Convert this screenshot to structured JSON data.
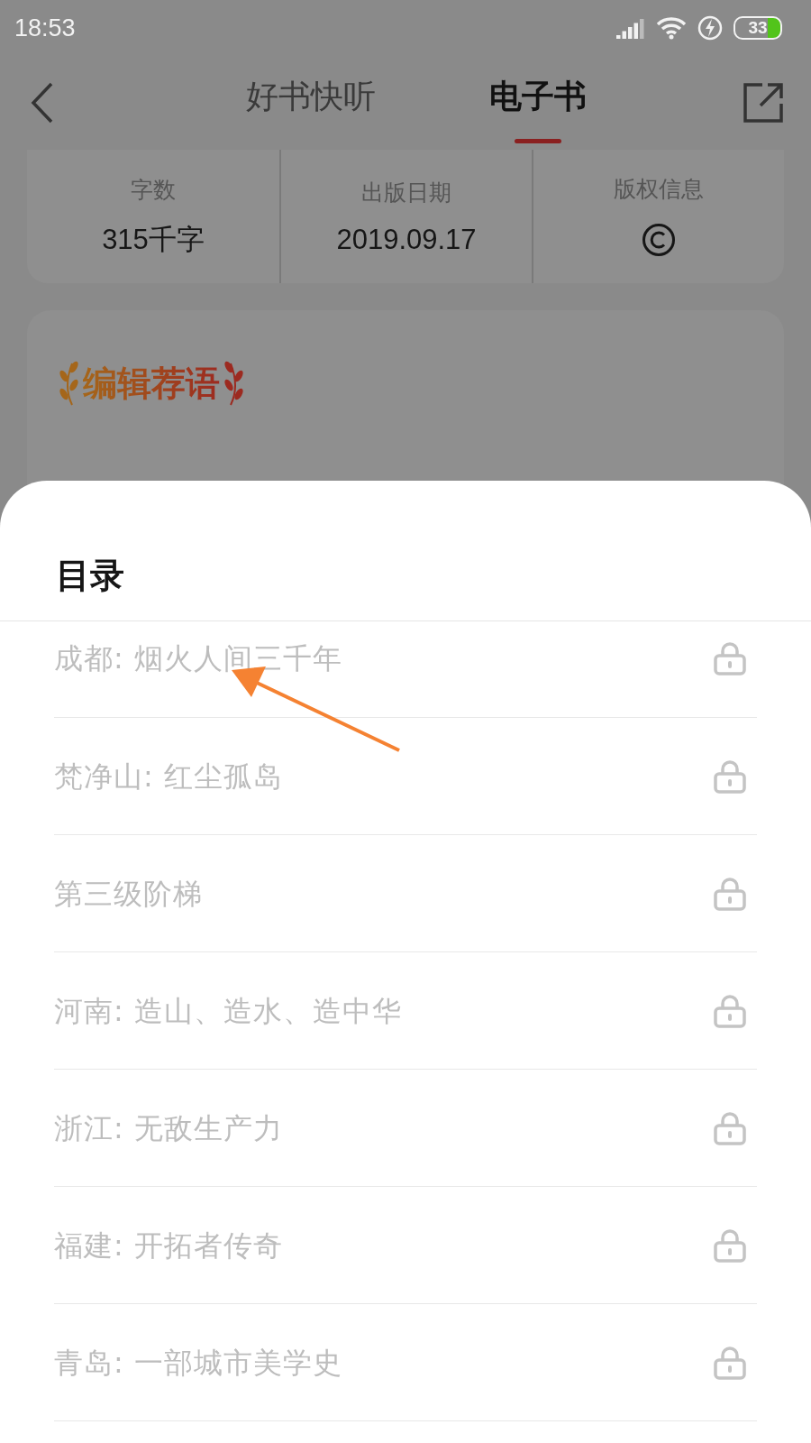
{
  "status_bar": {
    "time": "18:53",
    "battery": "33"
  },
  "header": {
    "tabs": [
      {
        "label": "好书快听",
        "selected": false
      },
      {
        "label": "电子书",
        "selected": true
      }
    ]
  },
  "stats": [
    {
      "label": "字数",
      "kind": "text",
      "value": "315千字"
    },
    {
      "label": "出版日期",
      "kind": "text",
      "value": "2019.09.17"
    },
    {
      "label": "版权信息",
      "kind": "icon"
    }
  ],
  "editor_section": {
    "title": "编辑荐语"
  },
  "toc_sheet": {
    "title": "目录",
    "chapters": [
      {
        "title": "成都: 烟火人间三千年",
        "locked": true
      },
      {
        "title": "梵净山: 红尘孤岛",
        "locked": true
      },
      {
        "title": "第三级阶梯",
        "locked": true
      },
      {
        "title": "河南: 造山、造水、造中华",
        "locked": true
      },
      {
        "title": "浙江: 无敌生产力",
        "locked": true
      },
      {
        "title": "福建: 开拓者传奇",
        "locked": true
      },
      {
        "title": "青岛: 一部城市美学史",
        "locked": true
      }
    ]
  }
}
